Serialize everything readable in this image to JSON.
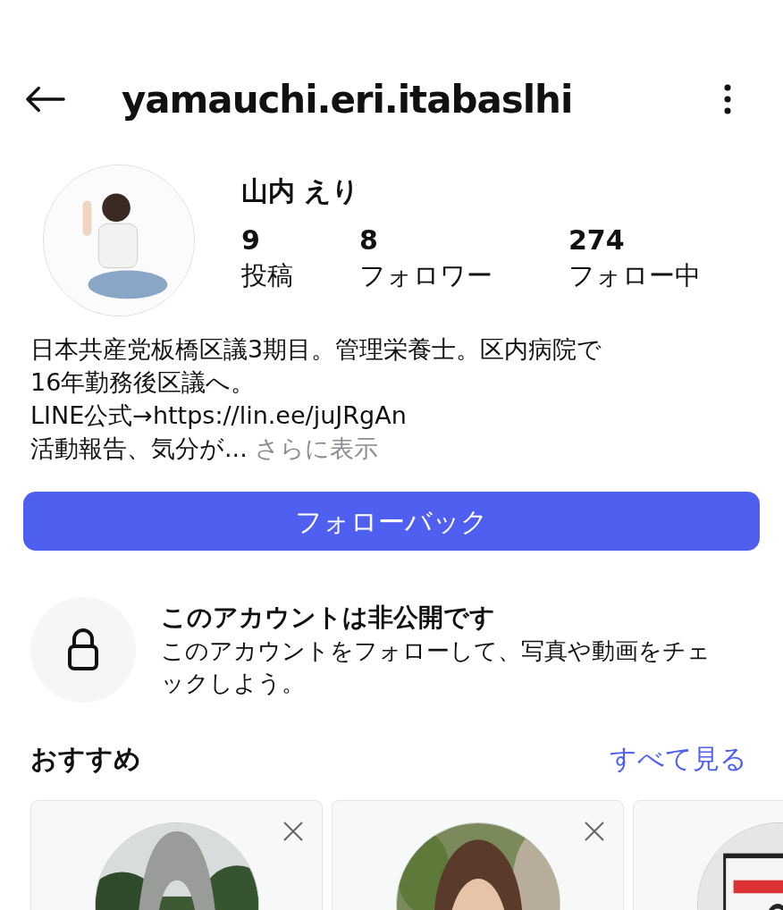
{
  "header": {
    "username": "yamauchi.eri.itabaslhi"
  },
  "profile": {
    "display_name": "山内 えり",
    "stats": [
      {
        "value": "9",
        "label": "投稿"
      },
      {
        "value": "8",
        "label": "フォロワー"
      },
      {
        "value": "274",
        "label": "フォロー中"
      }
    ]
  },
  "bio": {
    "lines": [
      "日本共産党板橋区議3期目。管理栄養士。区内病院で",
      "16年勤務後区議へ。",
      "LINE公式→https://lin.ee/juJRgAn",
      "活動報告、気分が..."
    ],
    "more_link": "さらに表示"
  },
  "follow_button": "フォローバック",
  "private_notice": {
    "title": "このアカウントは非公開です",
    "message": "このアカウントをフォローして、写真や動画をチェックしよう。"
  },
  "suggestions": {
    "title": "おすすめ",
    "see_all": "すべて見る",
    "cards": [
      {
        "kind": "arch"
      },
      {
        "kind": "portrait"
      },
      {
        "kind": "sketch"
      }
    ]
  }
}
